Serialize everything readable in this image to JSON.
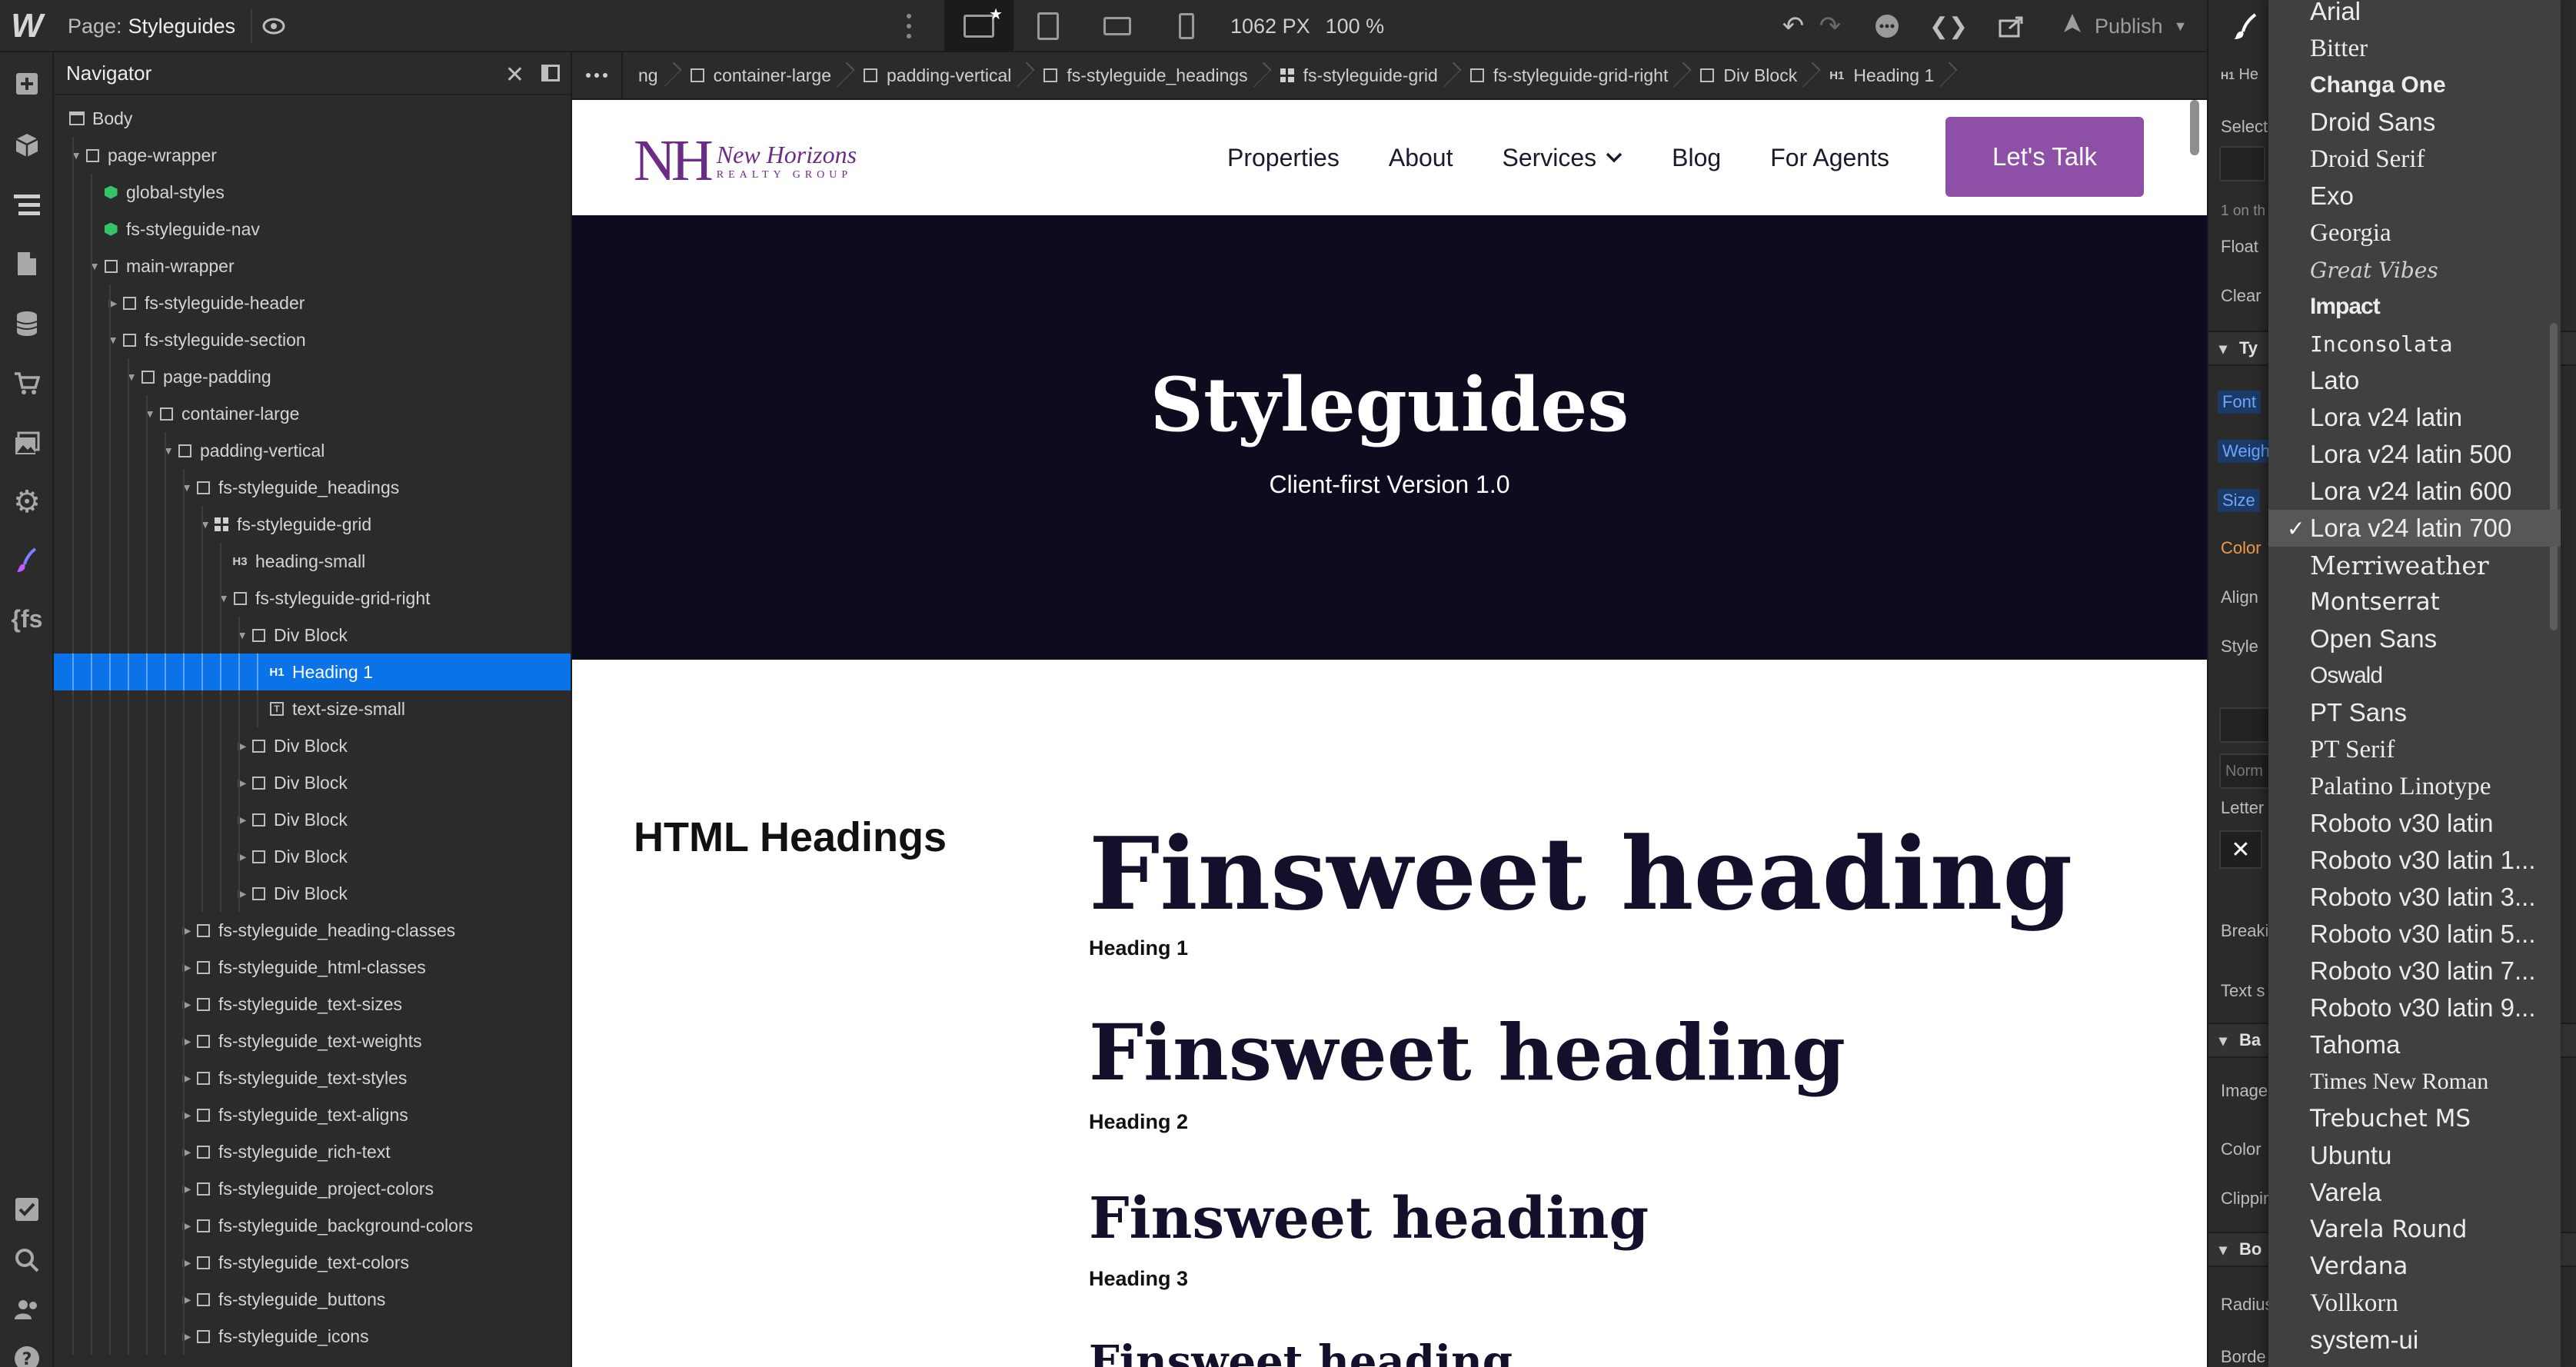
{
  "app": {
    "logo": "W"
  },
  "topbar": {
    "page_prefix": "Page:",
    "page_name": "Styleguides",
    "width": "1062 PX",
    "zoom": "100 %",
    "publish": "Publish"
  },
  "navigator": {
    "title": "Navigator",
    "rows": [
      {
        "label": "Body",
        "icon": "body-icon",
        "depth": 0,
        "caret": ""
      },
      {
        "label": "page-wrapper",
        "icon": "box",
        "depth": 1,
        "caret": "▼"
      },
      {
        "label": "global-styles",
        "icon": "component",
        "depth": 2,
        "caret": ""
      },
      {
        "label": "fs-styleguide-nav",
        "icon": "component",
        "depth": 2,
        "caret": ""
      },
      {
        "label": "main-wrapper",
        "icon": "box",
        "depth": 2,
        "caret": "▼"
      },
      {
        "label": "fs-styleguide-header",
        "icon": "box",
        "depth": 3,
        "caret": "▶"
      },
      {
        "label": "fs-styleguide-section",
        "icon": "box",
        "depth": 3,
        "caret": "▼"
      },
      {
        "label": "page-padding",
        "icon": "box",
        "depth": 4,
        "caret": "▼"
      },
      {
        "label": "container-large",
        "icon": "box",
        "depth": 5,
        "caret": "▼"
      },
      {
        "label": "padding-vertical",
        "icon": "box",
        "depth": 6,
        "caret": "▼"
      },
      {
        "label": "fs-styleguide_headings",
        "icon": "box",
        "depth": 7,
        "caret": "▼"
      },
      {
        "label": "fs-styleguide-grid",
        "icon": "grid",
        "depth": 8,
        "caret": "▼"
      },
      {
        "label": "heading-small",
        "icon": "h3",
        "depth": 9,
        "caret": ""
      },
      {
        "label": "fs-styleguide-grid-right",
        "icon": "box",
        "depth": 9,
        "caret": "▼"
      },
      {
        "label": "Div Block",
        "icon": "box",
        "depth": 10,
        "caret": "▼"
      },
      {
        "label": "Heading 1",
        "icon": "h1",
        "depth": 11,
        "caret": "",
        "selected": true
      },
      {
        "label": "text-size-small",
        "icon": "text",
        "depth": 11,
        "caret": ""
      },
      {
        "label": "Div Block",
        "icon": "box",
        "depth": 10,
        "caret": "▶"
      },
      {
        "label": "Div Block",
        "icon": "box",
        "depth": 10,
        "caret": "▶"
      },
      {
        "label": "Div Block",
        "icon": "box",
        "depth": 10,
        "caret": "▶"
      },
      {
        "label": "Div Block",
        "icon": "box",
        "depth": 10,
        "caret": "▶"
      },
      {
        "label": "Div Block",
        "icon": "box",
        "depth": 10,
        "caret": "▶"
      },
      {
        "label": "fs-styleguide_heading-classes",
        "icon": "box",
        "depth": 7,
        "caret": "▶"
      },
      {
        "label": "fs-styleguide_html-classes",
        "icon": "box",
        "depth": 7,
        "caret": "▶"
      },
      {
        "label": "fs-styleguide_text-sizes",
        "icon": "box",
        "depth": 7,
        "caret": "▶"
      },
      {
        "label": "fs-styleguide_text-weights",
        "icon": "box",
        "depth": 7,
        "caret": "▶"
      },
      {
        "label": "fs-styleguide_text-styles",
        "icon": "box",
        "depth": 7,
        "caret": "▶"
      },
      {
        "label": "fs-styleguide_text-aligns",
        "icon": "box",
        "depth": 7,
        "caret": "▶"
      },
      {
        "label": "fs-styleguide_rich-text",
        "icon": "box",
        "depth": 7,
        "caret": "▶"
      },
      {
        "label": "fs-styleguide_project-colors",
        "icon": "box",
        "depth": 7,
        "caret": "▶"
      },
      {
        "label": "fs-styleguide_background-colors",
        "icon": "box",
        "depth": 7,
        "caret": "▶"
      },
      {
        "label": "fs-styleguide_text-colors",
        "icon": "box",
        "depth": 7,
        "caret": "▶"
      },
      {
        "label": "fs-styleguide_buttons",
        "icon": "box",
        "depth": 7,
        "caret": "▶"
      },
      {
        "label": "fs-styleguide_icons",
        "icon": "box",
        "depth": 7,
        "caret": "▶"
      }
    ]
  },
  "breadcrumbs": [
    {
      "label": "ng",
      "icon": ""
    },
    {
      "label": "container-large",
      "icon": "box"
    },
    {
      "label": "padding-vertical",
      "icon": "box"
    },
    {
      "label": "fs-styleguide_headings",
      "icon": "box"
    },
    {
      "label": "fs-styleguide-grid",
      "icon": "grid"
    },
    {
      "label": "fs-styleguide-grid-right",
      "icon": "box"
    },
    {
      "label": "Div Block",
      "icon": "box"
    },
    {
      "label": "Heading 1",
      "icon": "h1"
    }
  ],
  "site": {
    "brand_mono": "NH",
    "brand_name": "New Horizons",
    "brand_sub": "REALTY GROUP",
    "nav": [
      "Properties",
      "About",
      "Services",
      "Blog",
      "For Agents"
    ],
    "cta": "Let's Talk",
    "hero_title": "Styleguides",
    "hero_subtitle": "Client-first Version 1.0",
    "section_label": "HTML Headings",
    "samples": [
      {
        "text": "Finsweet heading",
        "caption": "Heading 1"
      },
      {
        "text": "Finsweet heading",
        "caption": "Heading 2"
      },
      {
        "text": "Finsweet heading",
        "caption": "Heading 3"
      },
      {
        "text": "Finsweet heading",
        "caption": ""
      }
    ]
  },
  "style_panel": {
    "h1_short": "He",
    "select_short": "Select",
    "on_short": "1 on th",
    "float": "Float",
    "clear": "Clear",
    "typography_short": "Ty",
    "font": "Font",
    "weight_short": "Weigh",
    "size": "Size",
    "color": "Color",
    "align": "Align",
    "style": "Style",
    "normal_short": "Norm",
    "letter": "Letter",
    "breaking_short": "Breaki",
    "text_s_short": "Text s",
    "background_short": "Ba",
    "image_short": "Image",
    "color2": "Color",
    "clipping_short": "Clippin",
    "borders_short": "Bo",
    "radius_short": "Radius",
    "borders2_short": "Borde"
  },
  "font_dropdown": {
    "selected": "Lora v24 latin 700",
    "fonts": [
      "Arial",
      "Bitter",
      "Changa One",
      "Droid Sans",
      "Droid Serif",
      "Exo",
      "Georgia",
      "Great Vibes",
      "Impact",
      "Inconsolata",
      "Lato",
      "Lora v24 latin",
      "Lora v24 latin 500",
      "Lora v24 latin 600",
      "Lora v24 latin 700",
      "Merriweather",
      "Montserrat",
      "Open Sans",
      "Oswald",
      "PT Sans",
      "PT Serif",
      "Palatino Linotype",
      "Roboto v30 latin",
      "Roboto v30 latin 1...",
      "Roboto v30 latin 3...",
      "Roboto v30 latin 5...",
      "Roboto v30 latin 7...",
      "Roboto v30 latin 9...",
      "Tahoma",
      "Times New Roman",
      "Trebuchet MS",
      "Ubuntu",
      "Varela",
      "Varela Round",
      "Verdana",
      "Vollkorn",
      "system-ui"
    ]
  },
  "colors": {
    "selection": "#0a73e8",
    "brand": "#6b2c86",
    "cta": "#8e4fa6",
    "hero": "#0d0c1f",
    "record": "#3f3ad4"
  }
}
